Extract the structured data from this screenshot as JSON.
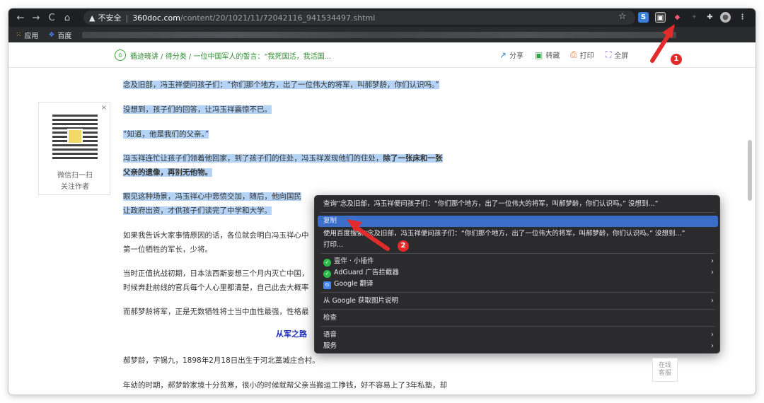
{
  "browser": {
    "security_label": "不安全",
    "url_host": "360doc.com",
    "url_path": "/content/20/1021/11/72042116_941534497.shtml",
    "bookmarks": [
      {
        "label": "应用"
      },
      {
        "label": "百度"
      }
    ]
  },
  "page_header": {
    "breadcrumb": "循迹晓讲 / 待分类 / 一位中国军人的誓言：“我死国活，我活国...",
    "tools": {
      "share": "分享",
      "repost": "转藏",
      "print": "打印",
      "fullscreen": "全屏"
    }
  },
  "qr_card": {
    "close": "×",
    "line1": "微信扫一扫",
    "line2": "关注作者"
  },
  "article": {
    "p1": "念及旧部，冯玉祥便问孩子们：“你们那个地方，出了一位伟大的将军，叫郝梦龄，你们认识吗。”",
    "p2": "没想到，孩子们的回答，让冯玉祥震惊不已。",
    "p3": "“知道，他是我们的父亲。”",
    "p4a": "冯玉祥连忙让孩子们领着他回家，到了孩子们的住处，冯玉祥发现他们的住处，",
    "p4b": "除了一张床和一张",
    "p4c": "父亲的遗像，再别无他物。",
    "p5a": "眼见这种场景，冯玉祥心中悲愤交加，随后，他向国民",
    "p5b": "让政府出资，才供孩子们读完了中学和大学。",
    "p6a": "如果我告诉大家事情原因的话，各位就会明白冯玉祥心中",
    "p6b": "第一位牺牲的军长，少将。",
    "p7a": "当时正值抗战初期，日本法西斯妄想三个月内灭亡中国，",
    "p7b": "时候奔赴前线的官兵每个人心里都清楚，自己此去大概率",
    "p8": "而郝梦龄将军，正是无数牺牲将士当中血性最强，性格最",
    "subhead": "从军之路",
    "p9": "郝梦龄，字锡九，1898年2月18日出生于河北藁城庄合村。",
    "p10": "年幼的时期，郝梦龄家境十分贫寒，很小的时候就帮父亲当搬运工挣钱，好不容易上了3年私塾，却"
  },
  "context_menu": {
    "items": [
      {
        "label": "查询“念及旧部，冯玉祥便问孩子们：“你们那个地方，出了一位伟大的将军，叫郝梦龄，你们认识吗。” 没想到...”"
      },
      {
        "label": "复制"
      },
      {
        "label": "使用百度搜索“念及旧部，冯玉祥便问孩子们：“你们那个地方，出了一位伟大的将军，叫郝梦龄，你们认识吗。” 没想到...”"
      },
      {
        "label": "打印..."
      },
      {
        "label": "壹伴 · 小插件"
      },
      {
        "label": "AdGuard 广告拦截器"
      },
      {
        "label": "Google 翻译"
      },
      {
        "label": "从 Google 获取图片说明"
      },
      {
        "label": "检查"
      },
      {
        "label": "语音"
      },
      {
        "label": "服务"
      }
    ]
  },
  "annotations": {
    "badge1": "1",
    "badge2": "2",
    "accent_red": "#e32b2b"
  },
  "side_widget": {
    "label_line1": "在线",
    "label_line2": "客服"
  }
}
